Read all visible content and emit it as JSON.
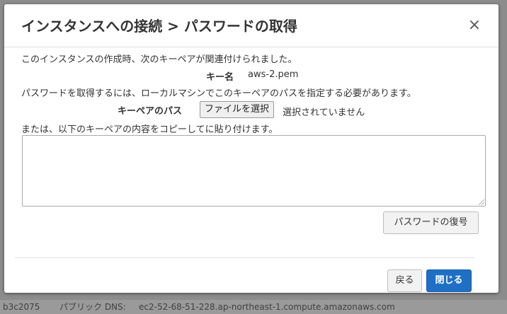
{
  "background": {
    "instance_id_fragment": "b3c2075",
    "dns_label": "パブリック DNS:",
    "dns_value": "ec2-52-68-51-228.ap-northeast-1.compute.amazonaws.com"
  },
  "modal": {
    "title": "インスタンスへの接続 > パスワードの取得",
    "close_symbol": "×",
    "intro_text": "このインスタンスの作成時、次のキーペアが関連付けられました。",
    "key_name_label": "キー名",
    "key_name_value": "aws-2.pem",
    "instruction_text": "パスワードを取得するには、ローカルマシンでこのキーペアのパスを指定する必要があります。",
    "key_path_label": "キーペアのパス",
    "file_button_label": "ファイルを選択",
    "file_status": "選択されていません",
    "paste_instruction": "または、以下のキーペアの内容をコピーしてに貼り付けます。",
    "key_content_value": "",
    "decrypt_button_label": "パスワードの復号",
    "back_button_label": "戻る",
    "close_button_label": "閉じる"
  },
  "colors": {
    "primary": "#1f6fc5",
    "overlay": "#8c8c8c"
  }
}
